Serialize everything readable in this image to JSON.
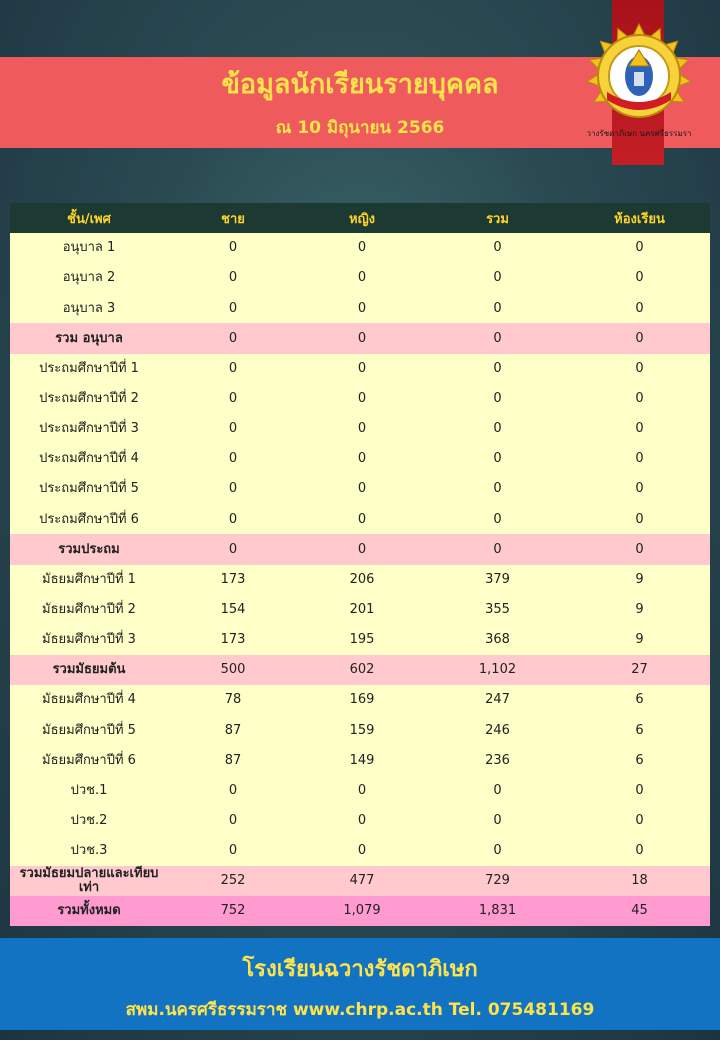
{
  "header": {
    "title": "ข้อมูลนักเรียนรายบุคคล",
    "subtitle": "ณ 10 มิถุนายน 2566",
    "emblem_text": "ฉวางรัชดาภิเษก นครศรีธรรมราช"
  },
  "table": {
    "columns": [
      "ชั้น/เพศ",
      "ชาย",
      "หญิง",
      "รวม",
      "ห้องเรียน"
    ],
    "rows": [
      {
        "type": "row",
        "cells": [
          "อนุบาล 1",
          "0",
          "0",
          "0",
          "0"
        ]
      },
      {
        "type": "row",
        "cells": [
          "อนุบาล 2",
          "0",
          "0",
          "0",
          "0"
        ]
      },
      {
        "type": "row",
        "cells": [
          "อนุบาล 3",
          "0",
          "0",
          "0",
          "0"
        ]
      },
      {
        "type": "sub",
        "cells": [
          "รวม อนุบาล",
          "0",
          "0",
          "0",
          "0"
        ]
      },
      {
        "type": "row",
        "cells": [
          "ประถมศึกษาปีที่ 1",
          "0",
          "0",
          "0",
          "0"
        ]
      },
      {
        "type": "row",
        "cells": [
          "ประถมศึกษาปีที่ 2",
          "0",
          "0",
          "0",
          "0"
        ]
      },
      {
        "type": "row",
        "cells": [
          "ประถมศึกษาปีที่ 3",
          "0",
          "0",
          "0",
          "0"
        ]
      },
      {
        "type": "row",
        "cells": [
          "ประถมศึกษาปีที่ 4",
          "0",
          "0",
          "0",
          "0"
        ]
      },
      {
        "type": "row",
        "cells": [
          "ประถมศึกษาปีที่ 5",
          "0",
          "0",
          "0",
          "0"
        ]
      },
      {
        "type": "row",
        "cells": [
          "ประถมศึกษาปีที่ 6",
          "0",
          "0",
          "0",
          "0"
        ]
      },
      {
        "type": "sub",
        "cells": [
          "รวมประถม",
          "0",
          "0",
          "0",
          "0"
        ]
      },
      {
        "type": "row",
        "cells": [
          "มัธยมศึกษาปีที่ 1",
          "173",
          "206",
          "379",
          "9"
        ]
      },
      {
        "type": "row",
        "cells": [
          "มัธยมศึกษาปีที่ 2",
          "154",
          "201",
          "355",
          "9"
        ]
      },
      {
        "type": "row",
        "cells": [
          "มัธยมศึกษาปีที่ 3",
          "173",
          "195",
          "368",
          "9"
        ]
      },
      {
        "type": "sub",
        "cells": [
          "รวมมัธยมต้น",
          "500",
          "602",
          "1,102",
          "27"
        ]
      },
      {
        "type": "row",
        "cells": [
          "มัธยมศึกษาปีที่ 4",
          "78",
          "169",
          "247",
          "6"
        ]
      },
      {
        "type": "row",
        "cells": [
          "มัธยมศึกษาปีที่ 5",
          "87",
          "159",
          "246",
          "6"
        ]
      },
      {
        "type": "row",
        "cells": [
          "มัธยมศึกษาปีที่ 6",
          "87",
          "149",
          "236",
          "6"
        ]
      },
      {
        "type": "row",
        "cells": [
          "ปวช.1",
          "0",
          "0",
          "0",
          "0"
        ]
      },
      {
        "type": "row",
        "cells": [
          "ปวช.2",
          "0",
          "0",
          "0",
          "0"
        ]
      },
      {
        "type": "row",
        "cells": [
          "ปวช.3",
          "0",
          "0",
          "0",
          "0"
        ]
      },
      {
        "type": "sub",
        "cells": [
          "รวมมัธยมปลายและเทียบเท่า",
          "252",
          "477",
          "729",
          "18"
        ]
      },
      {
        "type": "total",
        "cells": [
          "รวมทั้งหมด",
          "752",
          "1,079",
          "1,831",
          "45"
        ]
      }
    ]
  },
  "footer": {
    "school": "โรงเรียนฉวางรัชดาภิเษก",
    "contact": "สพม.นครศรีธรรมราช www.chrp.ac.th Tel. 075481169"
  },
  "colors": {
    "header_band": "#ef5a5c",
    "title_text": "#ffe34a",
    "table_header": "#1c3a32",
    "row_bg": "#ffffc8",
    "subtotal_bg": "#ffc9cd",
    "total_bg": "#ff9bd0",
    "footer_bg": "#1273c2"
  }
}
